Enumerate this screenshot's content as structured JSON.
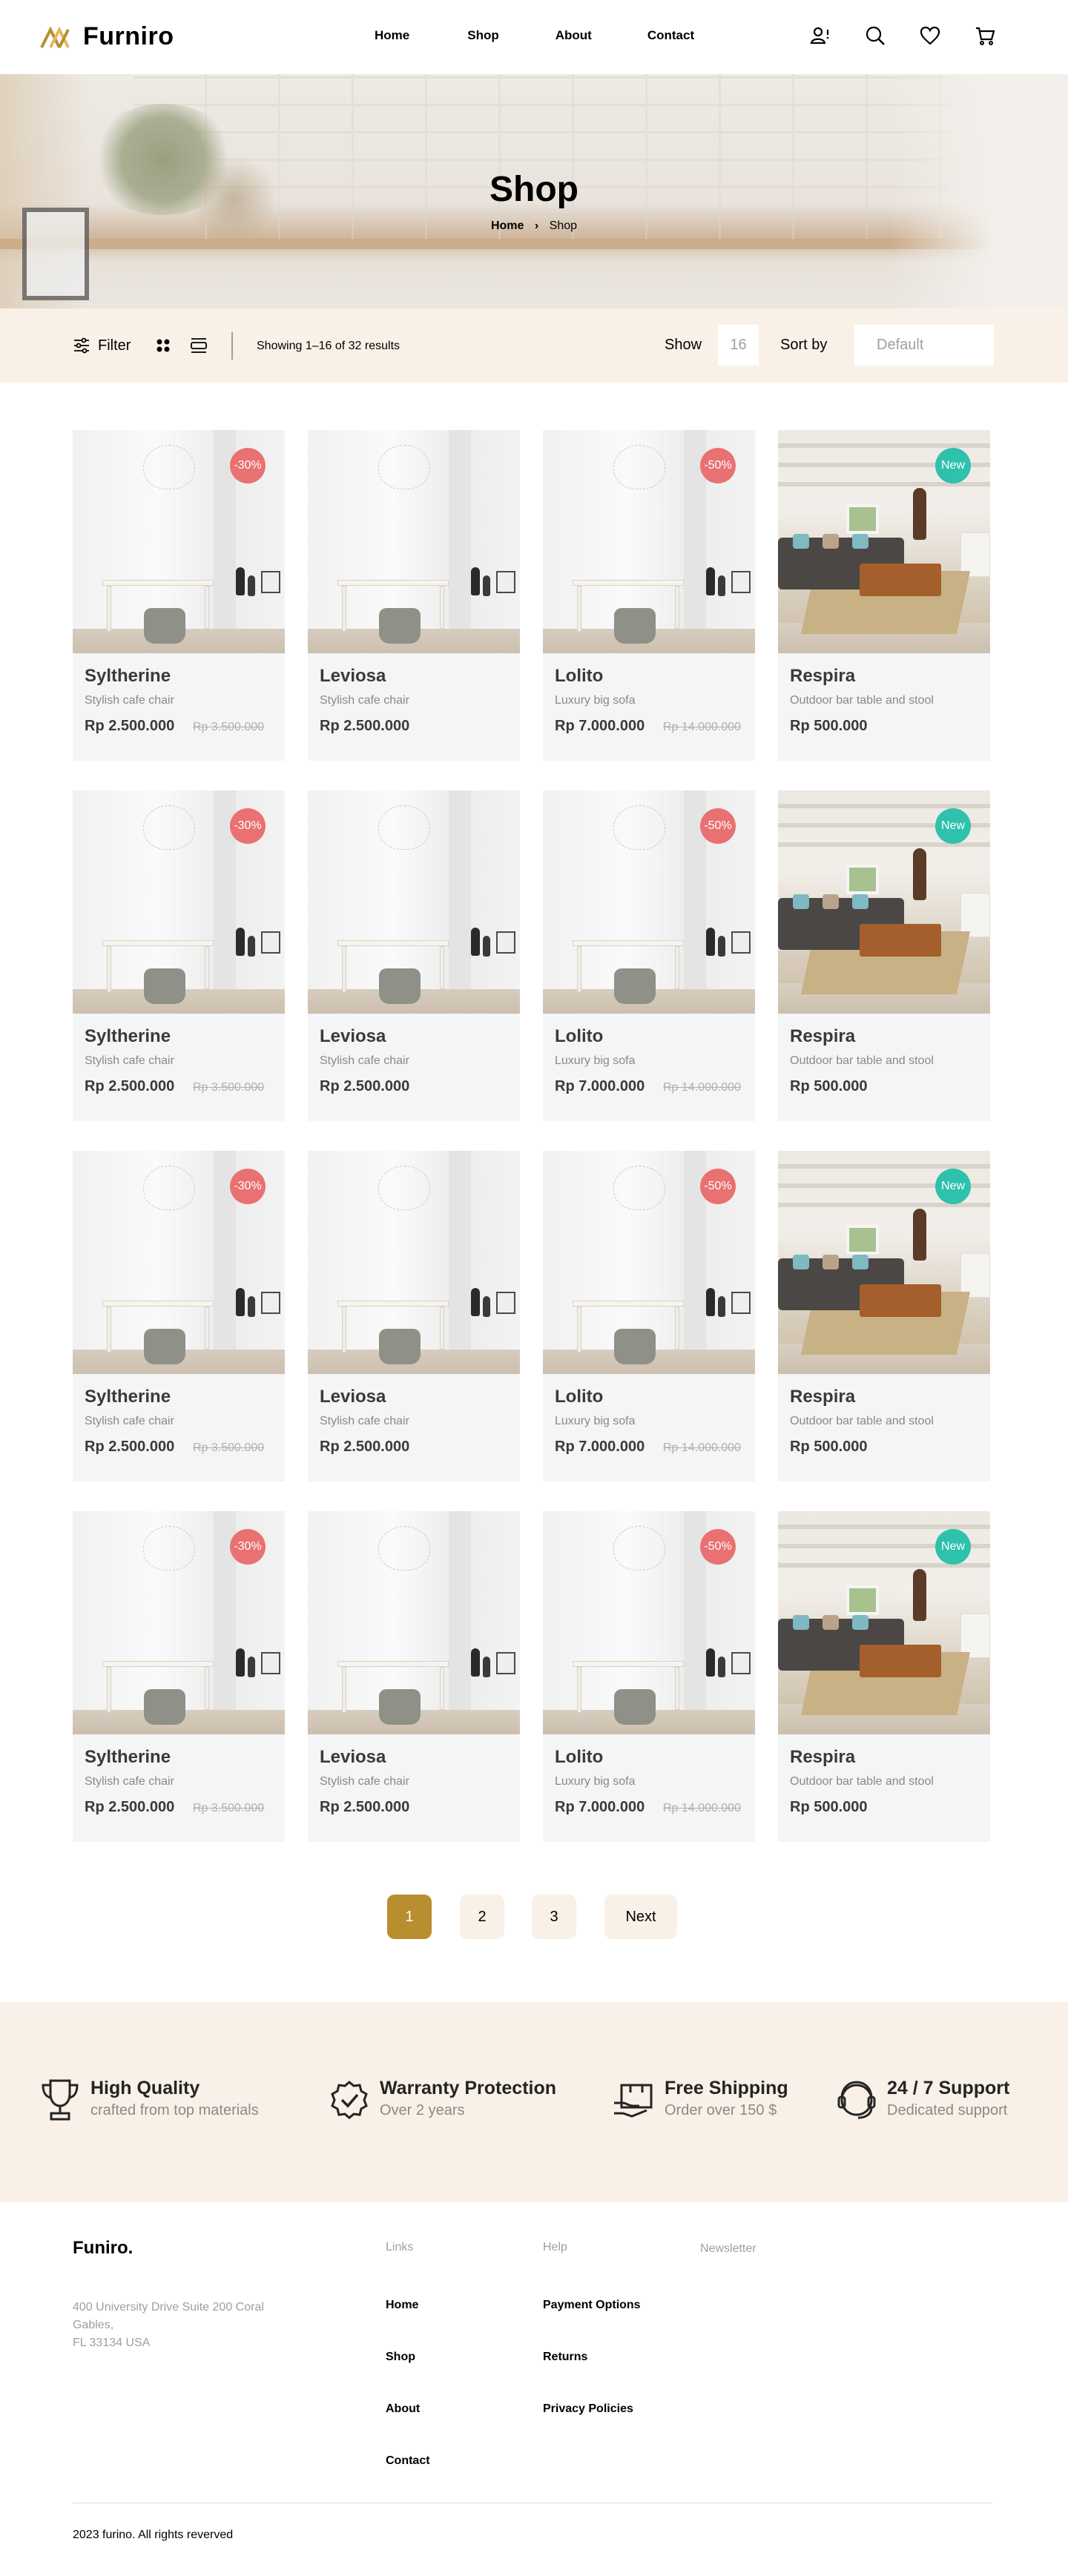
{
  "brand": {
    "name": "Furniro",
    "color": "#b88e2f"
  },
  "nav": {
    "items": [
      "Home",
      "Shop",
      "About",
      "Contact"
    ]
  },
  "header_icons": [
    "account-alert-icon",
    "search-icon",
    "heart-icon",
    "cart-icon"
  ],
  "hero": {
    "title": "Shop",
    "breadcrumb": {
      "home": "Home",
      "separator": "›",
      "current": "Shop"
    }
  },
  "filter_bar": {
    "filter_label": "Filter",
    "results_text": "Showing 1–16 of 32 results",
    "show_label": "Show",
    "show_value": "16",
    "sort_label": "Sort by",
    "sort_value": "Default"
  },
  "products": [
    {
      "name": "Syltherine",
      "desc": "Stylish cafe chair",
      "price": "Rp 2.500.000",
      "old_price": "Rp 3.500.000",
      "badge": "-30%",
      "badge_type": "sale",
      "image": "white"
    },
    {
      "name": "Leviosa",
      "desc": "Stylish cafe chair",
      "price": "Rp 2.500.000",
      "old_price": "",
      "badge": "",
      "badge_type": "",
      "image": "white"
    },
    {
      "name": "Lolito",
      "desc": "Luxury big sofa",
      "price": "Rp 7.000.000",
      "old_price": "Rp 14.000.000",
      "badge": "-50%",
      "badge_type": "sale",
      "image": "white"
    },
    {
      "name": "Respira",
      "desc": "Outdoor bar table and stool",
      "price": "Rp 500.000",
      "old_price": "",
      "badge": "New",
      "badge_type": "new",
      "image": "room"
    },
    {
      "name": "Syltherine",
      "desc": "Stylish cafe chair",
      "price": "Rp 2.500.000",
      "old_price": "Rp 3.500.000",
      "badge": "-30%",
      "badge_type": "sale",
      "image": "white"
    },
    {
      "name": "Leviosa",
      "desc": "Stylish cafe chair",
      "price": "Rp 2.500.000",
      "old_price": "",
      "badge": "",
      "badge_type": "",
      "image": "white"
    },
    {
      "name": "Lolito",
      "desc": "Luxury big sofa",
      "price": "Rp 7.000.000",
      "old_price": "Rp 14.000.000",
      "badge": "-50%",
      "badge_type": "sale",
      "image": "white"
    },
    {
      "name": "Respira",
      "desc": "Outdoor bar table and stool",
      "price": "Rp 500.000",
      "old_price": "",
      "badge": "New",
      "badge_type": "new",
      "image": "room"
    },
    {
      "name": "Syltherine",
      "desc": "Stylish cafe chair",
      "price": "Rp 2.500.000",
      "old_price": "Rp 3.500.000",
      "badge": "-30%",
      "badge_type": "sale",
      "image": "white"
    },
    {
      "name": "Leviosa",
      "desc": "Stylish cafe chair",
      "price": "Rp 2.500.000",
      "old_price": "",
      "badge": "",
      "badge_type": "",
      "image": "white"
    },
    {
      "name": "Lolito",
      "desc": "Luxury big sofa",
      "price": "Rp 7.000.000",
      "old_price": "Rp 14.000.000",
      "badge": "-50%",
      "badge_type": "sale",
      "image": "white"
    },
    {
      "name": "Respira",
      "desc": "Outdoor bar table and stool",
      "price": "Rp 500.000",
      "old_price": "",
      "badge": "New",
      "badge_type": "new",
      "image": "room"
    },
    {
      "name": "Syltherine",
      "desc": "Stylish cafe chair",
      "price": "Rp 2.500.000",
      "old_price": "Rp 3.500.000",
      "badge": "-30%",
      "badge_type": "sale",
      "image": "white"
    },
    {
      "name": "Leviosa",
      "desc": "Stylish cafe chair",
      "price": "Rp 2.500.000",
      "old_price": "",
      "badge": "",
      "badge_type": "",
      "image": "white"
    },
    {
      "name": "Lolito",
      "desc": "Luxury big sofa",
      "price": "Rp 7.000.000",
      "old_price": "Rp 14.000.000",
      "badge": "-50%",
      "badge_type": "sale",
      "image": "white"
    },
    {
      "name": "Respira",
      "desc": "Outdoor bar table and stool",
      "price": "Rp 500.000",
      "old_price": "",
      "badge": "New",
      "badge_type": "new",
      "image": "room"
    }
  ],
  "colors": {
    "sale_badge": "#e97171",
    "new_badge": "#2ec1ac",
    "accent": "#b88e2f",
    "cream": "#f9f1e7"
  },
  "pagination": {
    "pages": [
      "1",
      "2",
      "3"
    ],
    "active": "1",
    "next_label": "Next"
  },
  "features": [
    {
      "icon": "trophy-icon",
      "title": "High Quality",
      "subtitle": "crafted from top materials"
    },
    {
      "icon": "warranty-badge-icon",
      "title": "Warranty Protection",
      "subtitle": "Over 2 years"
    },
    {
      "icon": "shipping-icon",
      "title": "Free Shipping",
      "subtitle": "Order over 150 $"
    },
    {
      "icon": "support-icon",
      "title": "24 / 7 Support",
      "subtitle": "Dedicated support"
    }
  ],
  "footer": {
    "brand": "Funiro.",
    "address": [
      "400 University Drive Suite 200 Coral",
      "Gables,",
      "FL 33134 USA"
    ],
    "links_title": "Links",
    "links": [
      "Home",
      "Shop",
      "About",
      "Contact"
    ],
    "help_title": "Help",
    "help_links": [
      "Payment Options",
      "Returns",
      "Privacy Policies"
    ],
    "newsletter_title": "Newsletter",
    "copyright": "2023 furino. All rights reverved"
  }
}
